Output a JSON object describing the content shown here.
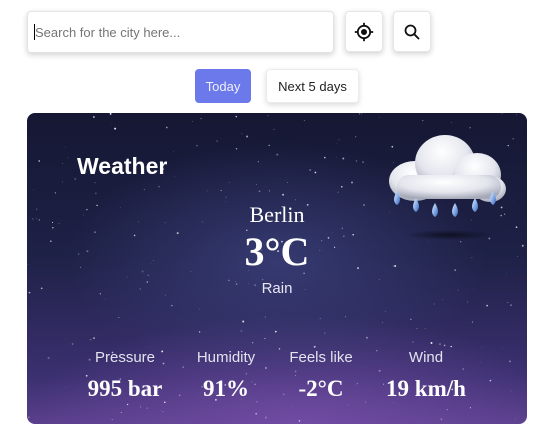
{
  "search": {
    "placeholder": "Search for the city here...",
    "value": ""
  },
  "toolbar": {
    "location_icon": "crosshair-location-icon",
    "search_icon": "magnifier-search-icon"
  },
  "tabs": [
    {
      "label": "Today",
      "active": true
    },
    {
      "label": "Next 5 days",
      "active": false
    }
  ],
  "colors": {
    "accent": "#6c79ea",
    "card_top": "#151733",
    "card_bottom": "#5a3f8c"
  },
  "weather": {
    "title": "Weather",
    "icon": "rain-cloud-icon",
    "city": "Berlin",
    "temperature": "3°C",
    "condition": "Rain"
  },
  "stats": {
    "pressure": {
      "label": "Pressure",
      "value": "995 bar"
    },
    "humidity": {
      "label": "Humidity",
      "value": "91%"
    },
    "feels_like": {
      "label": "Feels like",
      "value": "-2°C"
    },
    "wind": {
      "label": "Wind",
      "value": "19 km/h"
    }
  }
}
